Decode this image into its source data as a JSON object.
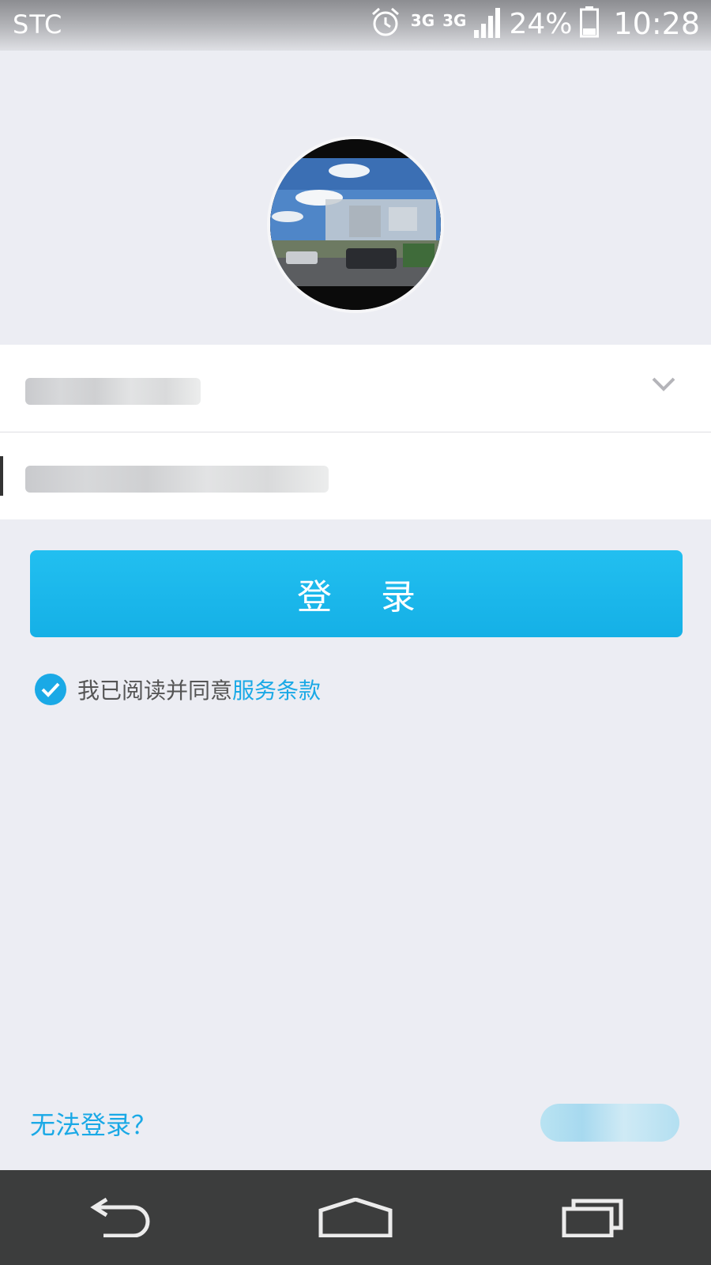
{
  "status_bar": {
    "carrier": "STC",
    "network_1": "3G",
    "network_2": "3G",
    "battery": "24%",
    "time": "10:28",
    "icons": [
      "alarm-icon",
      "signal-icon",
      "battery-icon"
    ]
  },
  "login": {
    "button_label": "登 录",
    "terms_prefix": "我已阅读并同意",
    "terms_link": "服务条款",
    "cant_login": "无法登录？"
  },
  "nav_icons": [
    "back-icon",
    "home-icon",
    "recent-apps-icon"
  ],
  "colors": {
    "accent": "#1aa9e6",
    "button": "#1cb6ee",
    "background": "#ecedf3",
    "nav_bar": "#3c3d3d"
  }
}
